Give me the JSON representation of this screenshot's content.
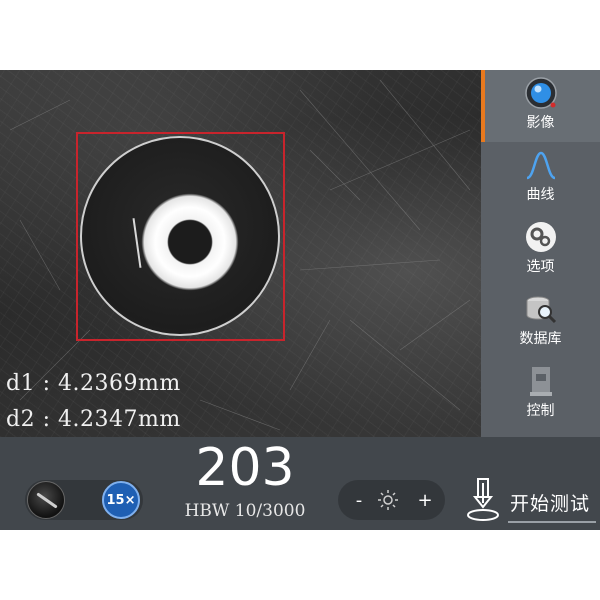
{
  "measurements": {
    "d1": "d1 : 4.2369mm",
    "d2": "d2 : 4.2347mm"
  },
  "sidebar": {
    "items": [
      {
        "label": "影像",
        "icon": "camera-lens-icon",
        "active": true
      },
      {
        "label": "曲线",
        "icon": "curve-icon",
        "active": false
      },
      {
        "label": "选项",
        "icon": "gears-icon",
        "active": false
      },
      {
        "label": "数据库",
        "icon": "database-search-icon",
        "active": false
      },
      {
        "label": "控制",
        "icon": "control-icon",
        "active": false
      }
    ]
  },
  "result": {
    "value": "203",
    "scale": "HBW 10/3000"
  },
  "objective": {
    "magnification": "15×"
  },
  "brightness": {
    "minus": "-",
    "plus": "+",
    "icon": "sun-icon"
  },
  "start": {
    "label": "开始测试",
    "icon": "indenter-icon"
  },
  "colors": {
    "accent": "#e8791e",
    "measure_box": "#c8242c",
    "badge": "#1f5fb3"
  }
}
